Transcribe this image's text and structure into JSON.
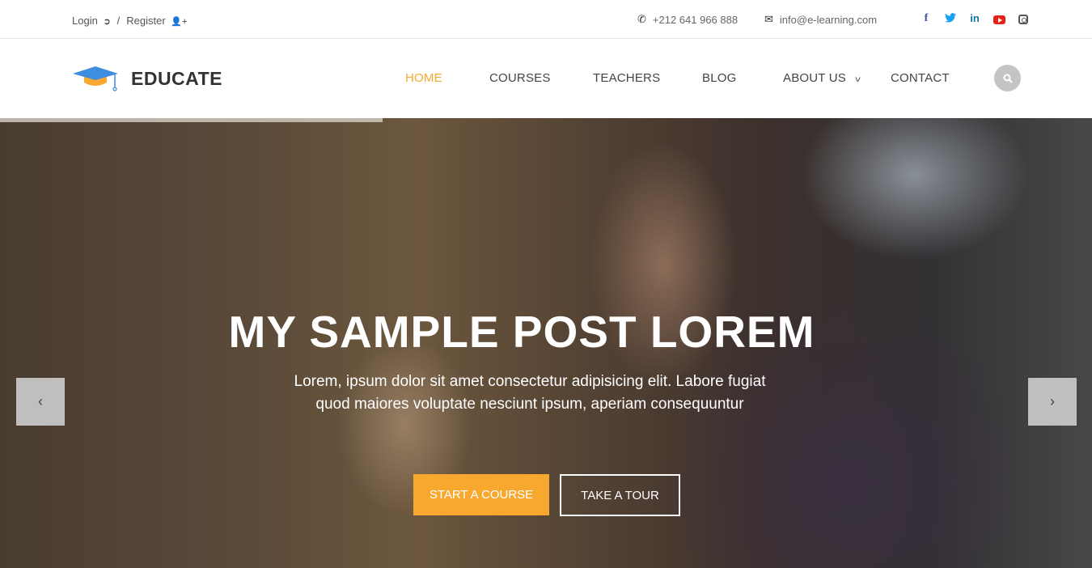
{
  "topbar": {
    "login_label": "Login",
    "separator": "/",
    "register_label": "Register",
    "phone": "+212 641 966 888",
    "email": "info@e-learning.com",
    "socials": [
      {
        "name": "facebook",
        "glyph": "f"
      },
      {
        "name": "twitter",
        "glyph": "🐦"
      },
      {
        "name": "linkedin",
        "glyph": "in"
      },
      {
        "name": "youtube",
        "glyph": ""
      },
      {
        "name": "instagram",
        "glyph": ""
      }
    ]
  },
  "brand": {
    "name": "EDUCATE",
    "colors": {
      "cap_blue": "#3d8ee0",
      "cap_orange": "#f9a82f"
    }
  },
  "nav": {
    "items": [
      {
        "label": "HOME",
        "active": true
      },
      {
        "label": "COURSES"
      },
      {
        "label": "TEACHERS"
      },
      {
        "label": "BLOG"
      },
      {
        "label": "ABOUT US",
        "has_dropdown": true
      },
      {
        "label": "CONTACT"
      }
    ],
    "dropdown_glyph": "⌄",
    "accent_color": "#f9a82f"
  },
  "hero": {
    "title": "MY SAMPLE POST LOREM",
    "subtitle_line1": "Lorem, ipsum dolor sit amet consectetur adipisicing elit. Labore fugiat",
    "subtitle_line2": "quod maiores voluptate nesciunt ipsum, aperiam consequuntur",
    "primary_button": "START A COURSE",
    "secondary_button": "TAKE A TOUR",
    "prev_glyph": "‹",
    "next_glyph": "›"
  }
}
